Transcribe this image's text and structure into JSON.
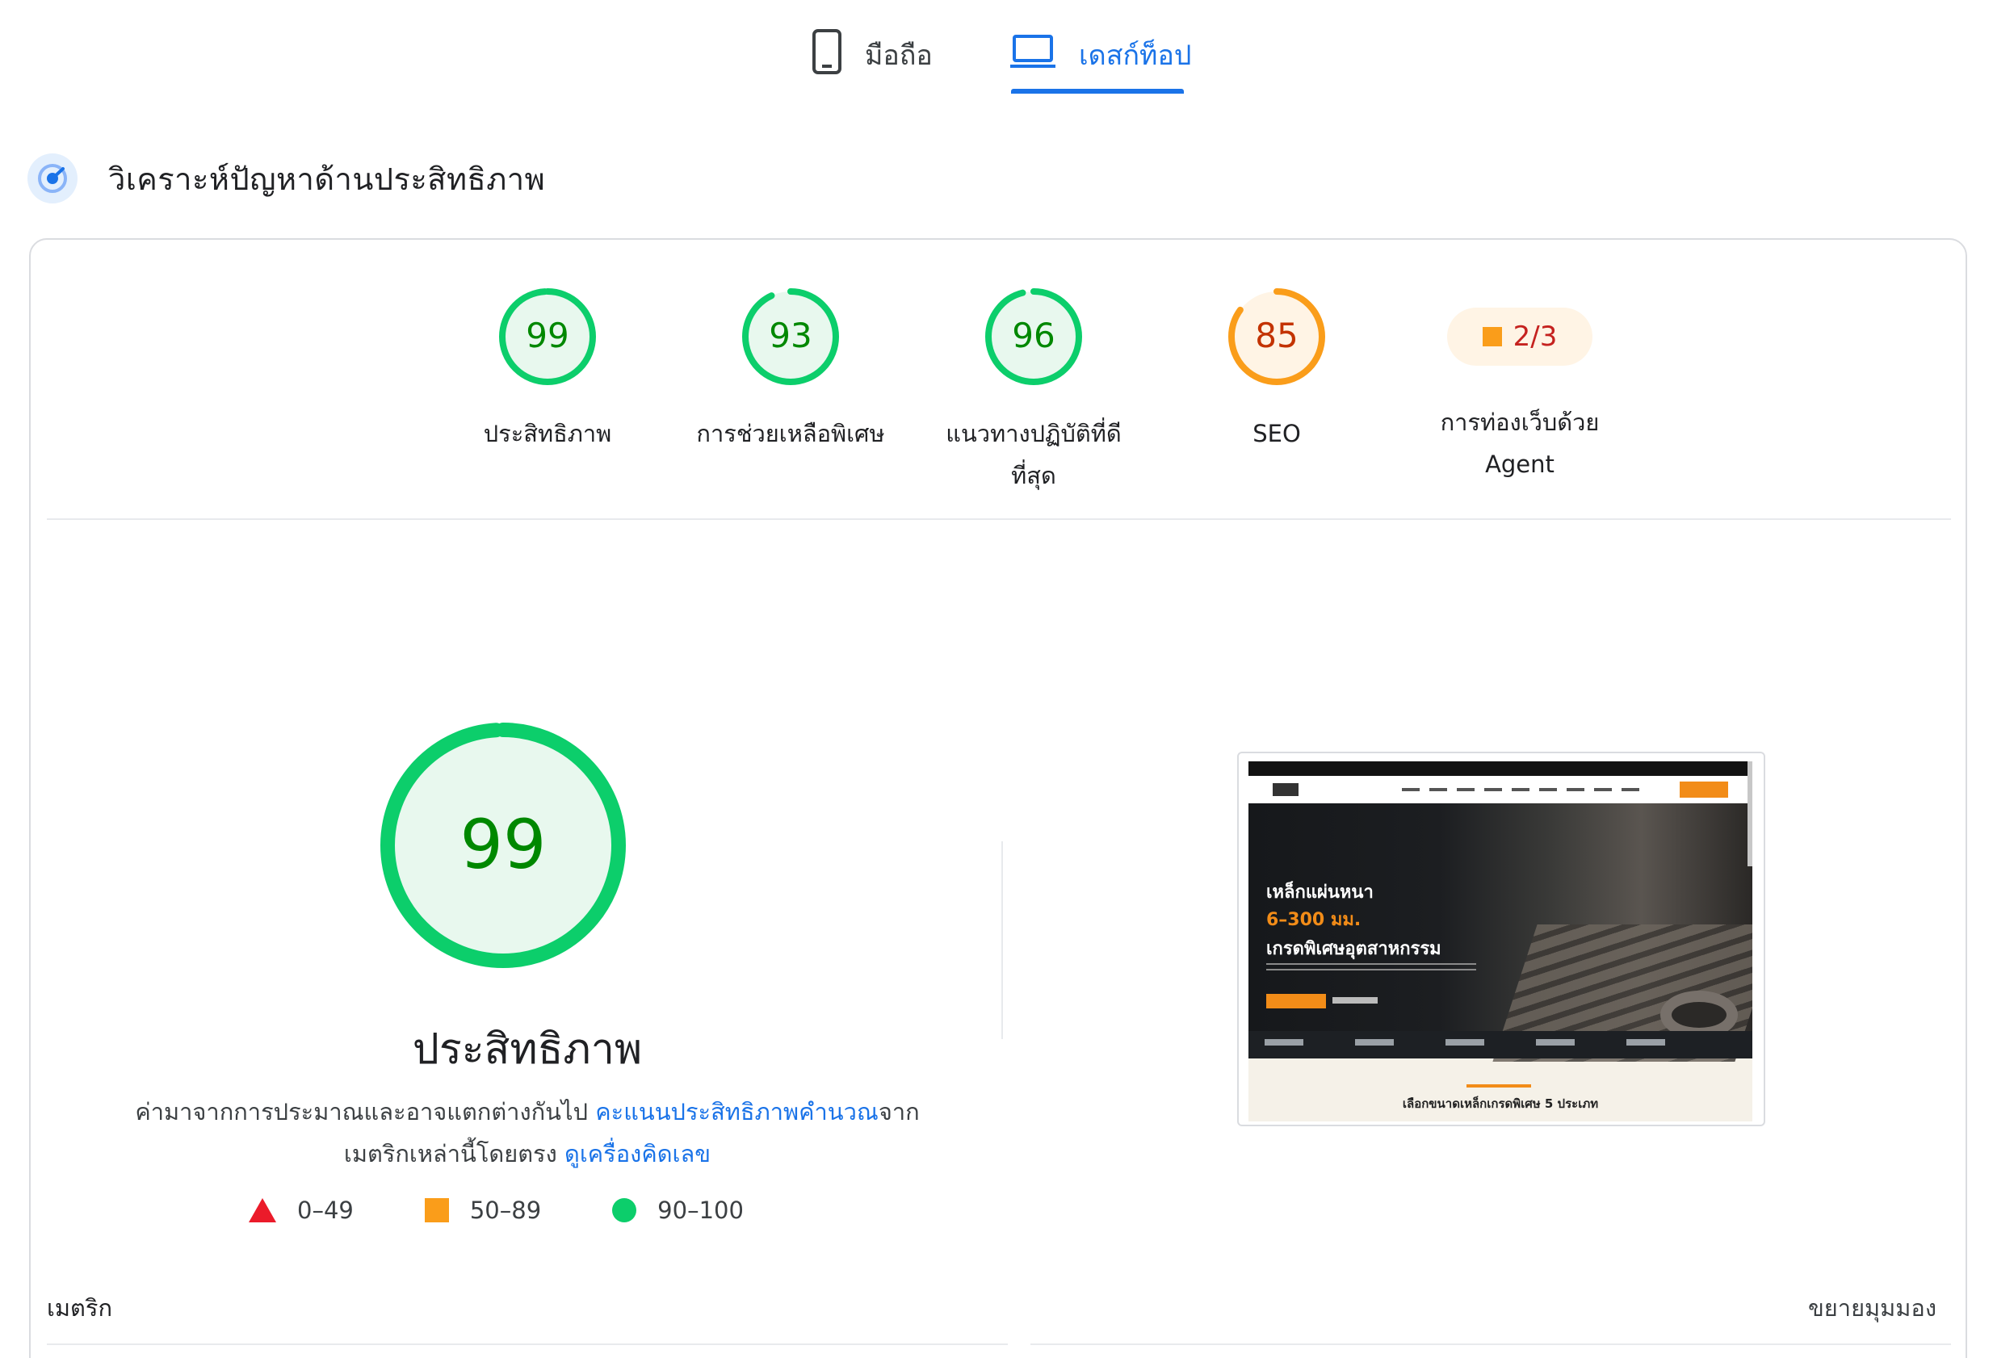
{
  "tabs": {
    "mobile": "มือถือ",
    "desktop": "เดสก์ท็อป",
    "active": "desktop"
  },
  "section_title": "วิเคราะห์ปัญหาด้านประสิทธิภาพ",
  "categories": [
    {
      "label": "ประสิทธิภาพ",
      "score": 99,
      "rating": "pass"
    },
    {
      "label": "การช่วยเหลือพิเศษ",
      "score": 93,
      "rating": "pass"
    },
    {
      "label_1": "แนวทางปฏิบัติที่ดี",
      "label_2": "ที่สุด",
      "score": 96,
      "rating": "pass"
    },
    {
      "label": "SEO",
      "score": 85,
      "rating": "average"
    },
    {
      "label_1": "การท่องเว็บด้วย",
      "label_2": "Agent",
      "score_text": "2/3",
      "rating": "average"
    }
  ],
  "main": {
    "score": 99,
    "title": "ประสิทธิภาพ",
    "desc_text_1": "ค่ามาจากการประมาณและอาจแตกต่างกันไป ",
    "desc_link_1": "คะแนนประสิทธิภาพคำนวณ",
    "desc_text_2": "จาก",
    "desc_text_3": "เมตริกเหล่านี้โดยตรง ",
    "desc_link_2": "ดูเครื่องคิดเลข"
  },
  "legend": [
    {
      "range": "0–49",
      "shape": "triangle",
      "color": "#eb1b2a"
    },
    {
      "range": "50–89",
      "shape": "square",
      "color": "#fa9d1a"
    },
    {
      "range": "90–100",
      "shape": "circle",
      "color": "#0cce6b"
    }
  ],
  "screenshot": {
    "hero_line_1": "เหล็กแผ่นหนา",
    "hero_line_2": "6–300 มม.",
    "hero_line_3": "เกรดพิเศษอุตสาหกรรม",
    "bottom_heading": "เลือกขนาดเหล็กเกรดพิเศษ 5 ประเภท"
  },
  "footer": {
    "metrics_label": "เมตริก",
    "expand_label": "ขยายมุมมอง"
  },
  "colors": {
    "pass": "#0cce6b",
    "pass_text": "#008800",
    "pass_fill": "#e8f8ee",
    "average": "#fa9d1a",
    "average_text": "#c33300",
    "average_fill": "#fff4e5",
    "accent": "#1a73e8"
  }
}
